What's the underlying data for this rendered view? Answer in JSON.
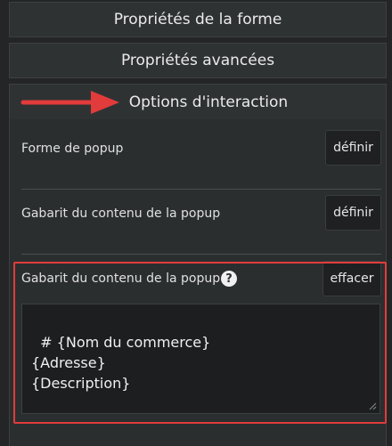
{
  "sections": {
    "shape_properties": "Propriétés de la forme",
    "advanced_properties": "Propriétés avancées",
    "interaction_options": "Options d'interaction"
  },
  "rows": [
    {
      "label": "Forme de popup",
      "button": "définir"
    },
    {
      "label": "Gabarit du contenu de la popup",
      "button": "définir"
    }
  ],
  "template_editor": {
    "label": "Gabarit du contenu de la popup",
    "help_glyph": "?",
    "clear_button": "effacer",
    "value": "# {Nom du commerce}\n{Adresse}\n{Description}"
  },
  "colors": {
    "accent_annotation": "#e23b3b",
    "background": "#232526",
    "panel": "#2b2e2f"
  },
  "icons": [
    "red-arrow-annotation-icon",
    "help-icon",
    "resize-handle-icon"
  ]
}
